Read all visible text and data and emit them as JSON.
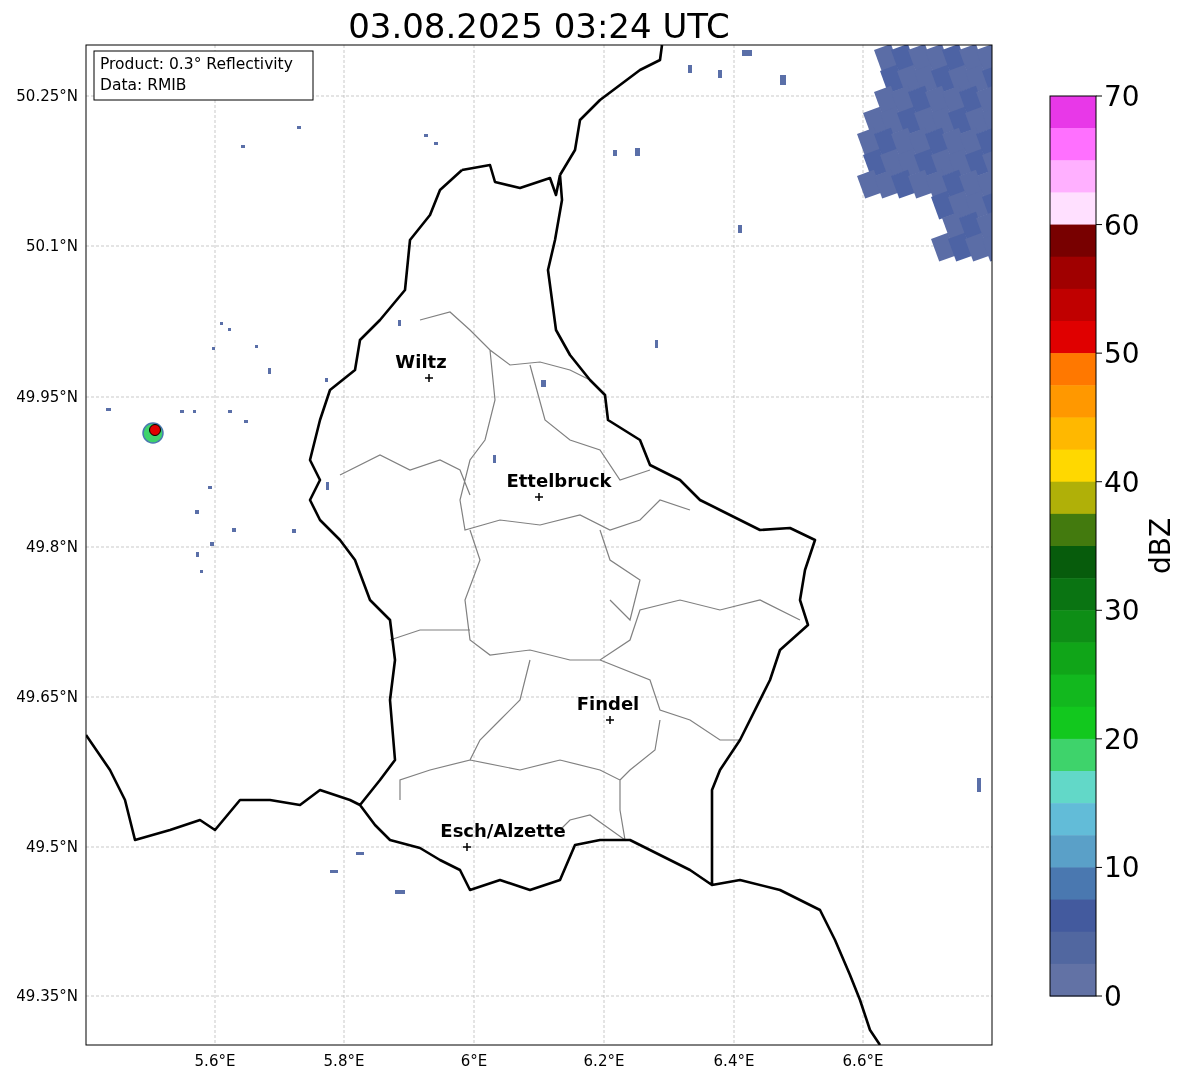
{
  "title": "03.08.2025 03:24 UTC",
  "info_box": {
    "lines": [
      "Product: 0.3° Reflectivity",
      "Data: RMIB"
    ]
  },
  "map": {
    "lat_labels": [
      "50.25°N",
      "50.1°N",
      "49.95°N",
      "49.8°N",
      "49.65°N",
      "49.5°N",
      "49.35°N"
    ],
    "lon_labels": [
      "5.6°E",
      "5.8°E",
      "6°E",
      "6.2°E",
      "6.4°E",
      "6.6°E"
    ],
    "cities": [
      {
        "name": "Wiltz"
      },
      {
        "name": "Ettelbruck"
      },
      {
        "name": "Findel"
      },
      {
        "name": "Esch/Alzette"
      }
    ]
  },
  "colorbar": {
    "label": "dBZ",
    "ticks": [
      "70",
      "60",
      "50",
      "40",
      "30",
      "20",
      "10",
      "0"
    ],
    "segments": [
      {
        "color": "#e838e8"
      },
      {
        "color": "#ff70ff"
      },
      {
        "color": "#ffb0ff"
      },
      {
        "color": "#ffe0ff"
      },
      {
        "color": "#780000"
      },
      {
        "color": "#a00000"
      },
      {
        "color": "#c00000"
      },
      {
        "color": "#e00000"
      },
      {
        "color": "#ff7800"
      },
      {
        "color": "#ff9800"
      },
      {
        "color": "#ffb800"
      },
      {
        "color": "#ffd800"
      },
      {
        "color": "#b0b008"
      },
      {
        "color": "#437a0e"
      },
      {
        "color": "#075c0c"
      },
      {
        "color": "#0a7412"
      },
      {
        "color": "#0e8e16"
      },
      {
        "color": "#10a518"
      },
      {
        "color": "#12b81e"
      },
      {
        "color": "#12c81e"
      },
      {
        "color": "#3ed36b"
      },
      {
        "color": "#62d8c8"
      },
      {
        "color": "#62bcd8"
      },
      {
        "color": "#5aa0c8"
      },
      {
        "color": "#4a78b0"
      },
      {
        "color": "#435a9e"
      },
      {
        "color": "#5167a0"
      },
      {
        "color": "#6272a5"
      }
    ]
  }
}
